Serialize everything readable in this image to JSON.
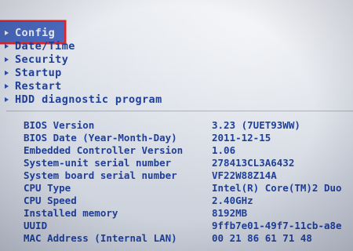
{
  "menu": {
    "items": [
      {
        "label": "Config",
        "selected": true
      },
      {
        "label": "Date/Time",
        "selected": false
      },
      {
        "label": "Security",
        "selected": false
      },
      {
        "label": "Startup",
        "selected": false
      },
      {
        "label": "Restart",
        "selected": false
      },
      {
        "label": "HDD diagnostic program",
        "selected": false
      }
    ],
    "highlight_color": "#e0262b"
  },
  "info": {
    "rows": [
      {
        "label": "BIOS Version",
        "value": "3.23  (7UET93WW)"
      },
      {
        "label": "BIOS Date (Year-Month-Day)",
        "value": "2011-12-15"
      },
      {
        "label": "Embedded Controller Version",
        "value": "1.06"
      },
      {
        "label": "System-unit serial number",
        "value": "278413CL3A6432"
      },
      {
        "label": "System board serial number",
        "value": "VF22W88Z14A"
      },
      {
        "label": "CPU Type",
        "value": "Intel(R) Core(TM)2 Duo"
      },
      {
        "label": "CPU Speed",
        "value": "2.40GHz"
      },
      {
        "label": "Installed memory",
        "value": "8192MB"
      },
      {
        "label": "UUID",
        "value": "9ffb7e01-49f7-11cb-a8e"
      },
      {
        "label": "MAC Address (Internal LAN)",
        "value": "00 21 86 61 71 48"
      }
    ]
  },
  "colors": {
    "text": "#1f3f9a",
    "background": "#d8dde6"
  }
}
